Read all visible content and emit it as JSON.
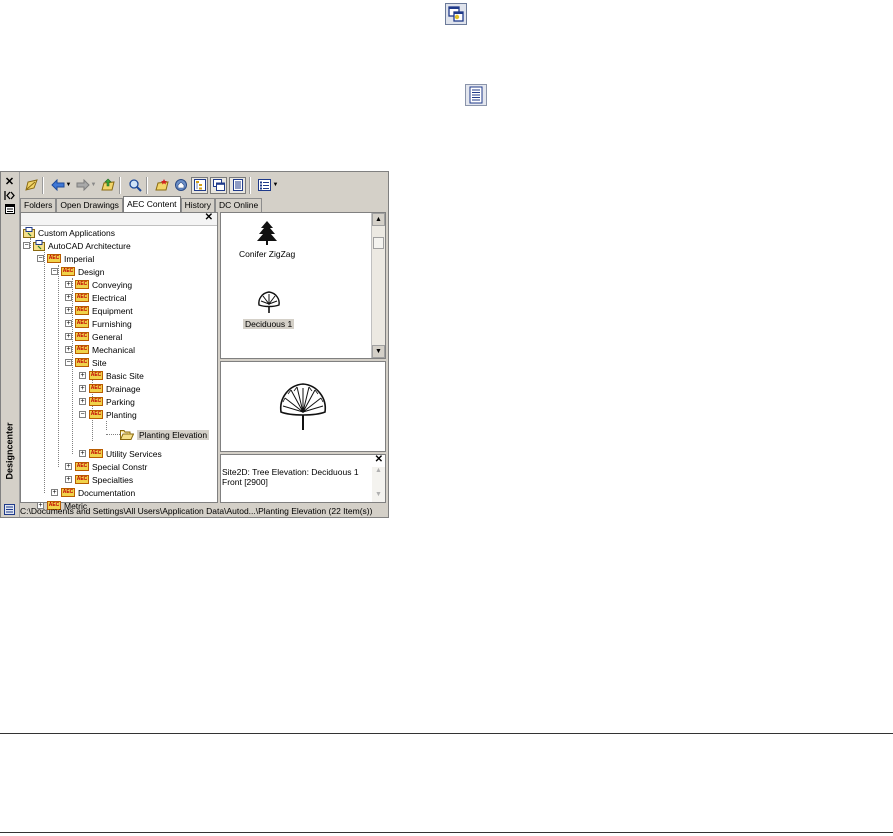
{
  "floating_icons": {
    "first": "window-overlap-icon",
    "second": "description-list-icon"
  },
  "window": {
    "title": "Designcenter",
    "title_buttons": [
      "close-icon",
      "auto-hide-icon",
      "properties-icon"
    ]
  },
  "toolbar": {
    "buttons": [
      "load-icon",
      "back-icon",
      "forward-icon",
      "up-icon",
      "search-icon",
      "favorites-icon",
      "home-icon",
      "tree-view-toggle-icon",
      "preview-icon",
      "description-icon",
      "views-icon"
    ]
  },
  "tabs": [
    "Folders",
    "Open Drawings",
    "AEC Content",
    "History",
    "DC Online"
  ],
  "active_tab": "AEC Content",
  "tree": {
    "nodes": [
      {
        "label": "Custom Applications",
        "icon": "app-icon"
      },
      {
        "label": "AutoCAD Architecture",
        "icon": "app-icon"
      },
      {
        "label": "Imperial",
        "icon": "aec-icon"
      },
      {
        "label": "Design",
        "icon": "aec-icon"
      },
      {
        "label": "Conveying",
        "icon": "aec-icon"
      },
      {
        "label": "Electrical",
        "icon": "aec-icon"
      },
      {
        "label": "Equipment",
        "icon": "aec-icon"
      },
      {
        "label": "Furnishing",
        "icon": "aec-icon"
      },
      {
        "label": "General",
        "icon": "aec-icon"
      },
      {
        "label": "Mechanical",
        "icon": "aec-icon"
      },
      {
        "label": "Site",
        "icon": "aec-icon"
      },
      {
        "label": "Basic Site",
        "icon": "aec-icon"
      },
      {
        "label": "Drainage",
        "icon": "aec-icon"
      },
      {
        "label": "Parking",
        "icon": "aec-icon"
      },
      {
        "label": "Planting",
        "icon": "aec-icon"
      },
      {
        "label": "Planting Elevation",
        "icon": "folder-icon"
      },
      {
        "label": "Utility Services",
        "icon": "aec-icon"
      },
      {
        "label": "Special Constr",
        "icon": "aec-icon"
      },
      {
        "label": "Specialties",
        "icon": "aec-icon"
      },
      {
        "label": "Documentation",
        "icon": "aec-icon"
      },
      {
        "label": "Metric",
        "icon": "aec-icon"
      }
    ],
    "selected": "Planting Elevation"
  },
  "content": {
    "items": [
      {
        "label": "Conifer ZigZag",
        "icon": "conifer-tree-icon"
      },
      {
        "label": "Deciduous 1",
        "icon": "deciduous-tree-icon"
      }
    ],
    "selected": "Deciduous 1"
  },
  "preview": {
    "icon": "tree-elevation-preview"
  },
  "description": {
    "line1": "Site2D: Tree Elevation: Deciduous 1",
    "line2": "Front [2900]"
  },
  "status": {
    "path": "C:\\Documents and Settings\\All Users\\Application Data\\Autod...\\Planting Elevation (22 Item(s))"
  }
}
